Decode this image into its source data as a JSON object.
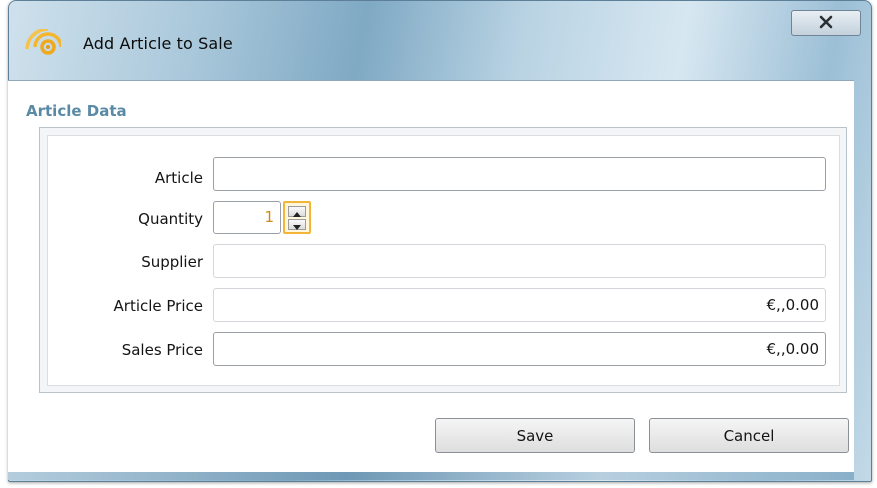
{
  "window": {
    "title": "Add Article to Sale",
    "app_icon": "concentric-arcs-icon",
    "close_icon": "close-x-icon"
  },
  "section": {
    "title": "Article Data"
  },
  "form": {
    "article_label": "Article",
    "article_value": "",
    "quantity_label": "Quantity",
    "quantity_value": "1",
    "supplier_label": "Supplier",
    "supplier_value": "",
    "article_price_label": "Article Price",
    "article_price_value": "€,,0.00",
    "sales_price_label": "Sales Price",
    "sales_price_value": "€,,0.00"
  },
  "buttons": {
    "save_label": "Save",
    "cancel_label": "Cancel"
  },
  "colors": {
    "accent": "#f2b53a",
    "section_title": "#5a8aa5"
  }
}
